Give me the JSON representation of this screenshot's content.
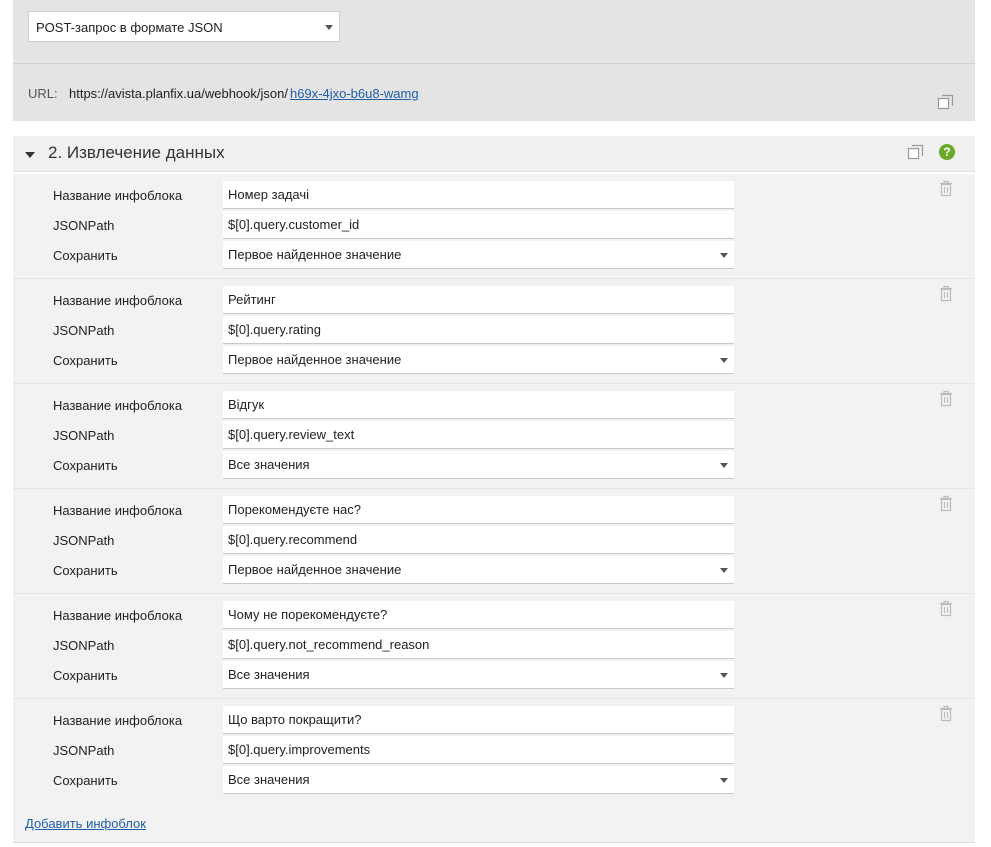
{
  "method": {
    "selected": "POST-запрос в формате JSON"
  },
  "url": {
    "label": "URL:",
    "base": "https://avista.planfix.ua/webhook/json/",
    "token": "h69x-4jxo-b6u8-wamg"
  },
  "section": {
    "title": "2. Извлечение данных",
    "help": "?"
  },
  "labels": {
    "name": "Название инфоблока",
    "path": "JSONPath",
    "save": "Сохранить"
  },
  "blocks": [
    {
      "name": "Номер задачі",
      "path": "$[0].query.customer_id",
      "save": "Первое найденное значение"
    },
    {
      "name": "Рейтинг",
      "path": "$[0].query.rating",
      "save": "Первое найденное значение"
    },
    {
      "name": "Відгук",
      "path": "$[0].query.review_text",
      "save": "Все значения"
    },
    {
      "name": "Порекомендуєте нас?",
      "path": "$[0].query.recommend",
      "save": "Первое найденное значение"
    },
    {
      "name": "Чому не порекомендуєте?",
      "path": "$[0].query.not_recommend_reason",
      "save": "Все значения"
    },
    {
      "name": "Що варто покращити?",
      "path": "$[0].query.improvements",
      "save": "Все значения"
    }
  ],
  "footer": {
    "add_label": "Добавить инфоблок"
  },
  "colors": {
    "accent": "#1f5ea8",
    "help": "#6aaa2a",
    "panel": "#e4e4e4",
    "block": "#f2f2f2"
  }
}
